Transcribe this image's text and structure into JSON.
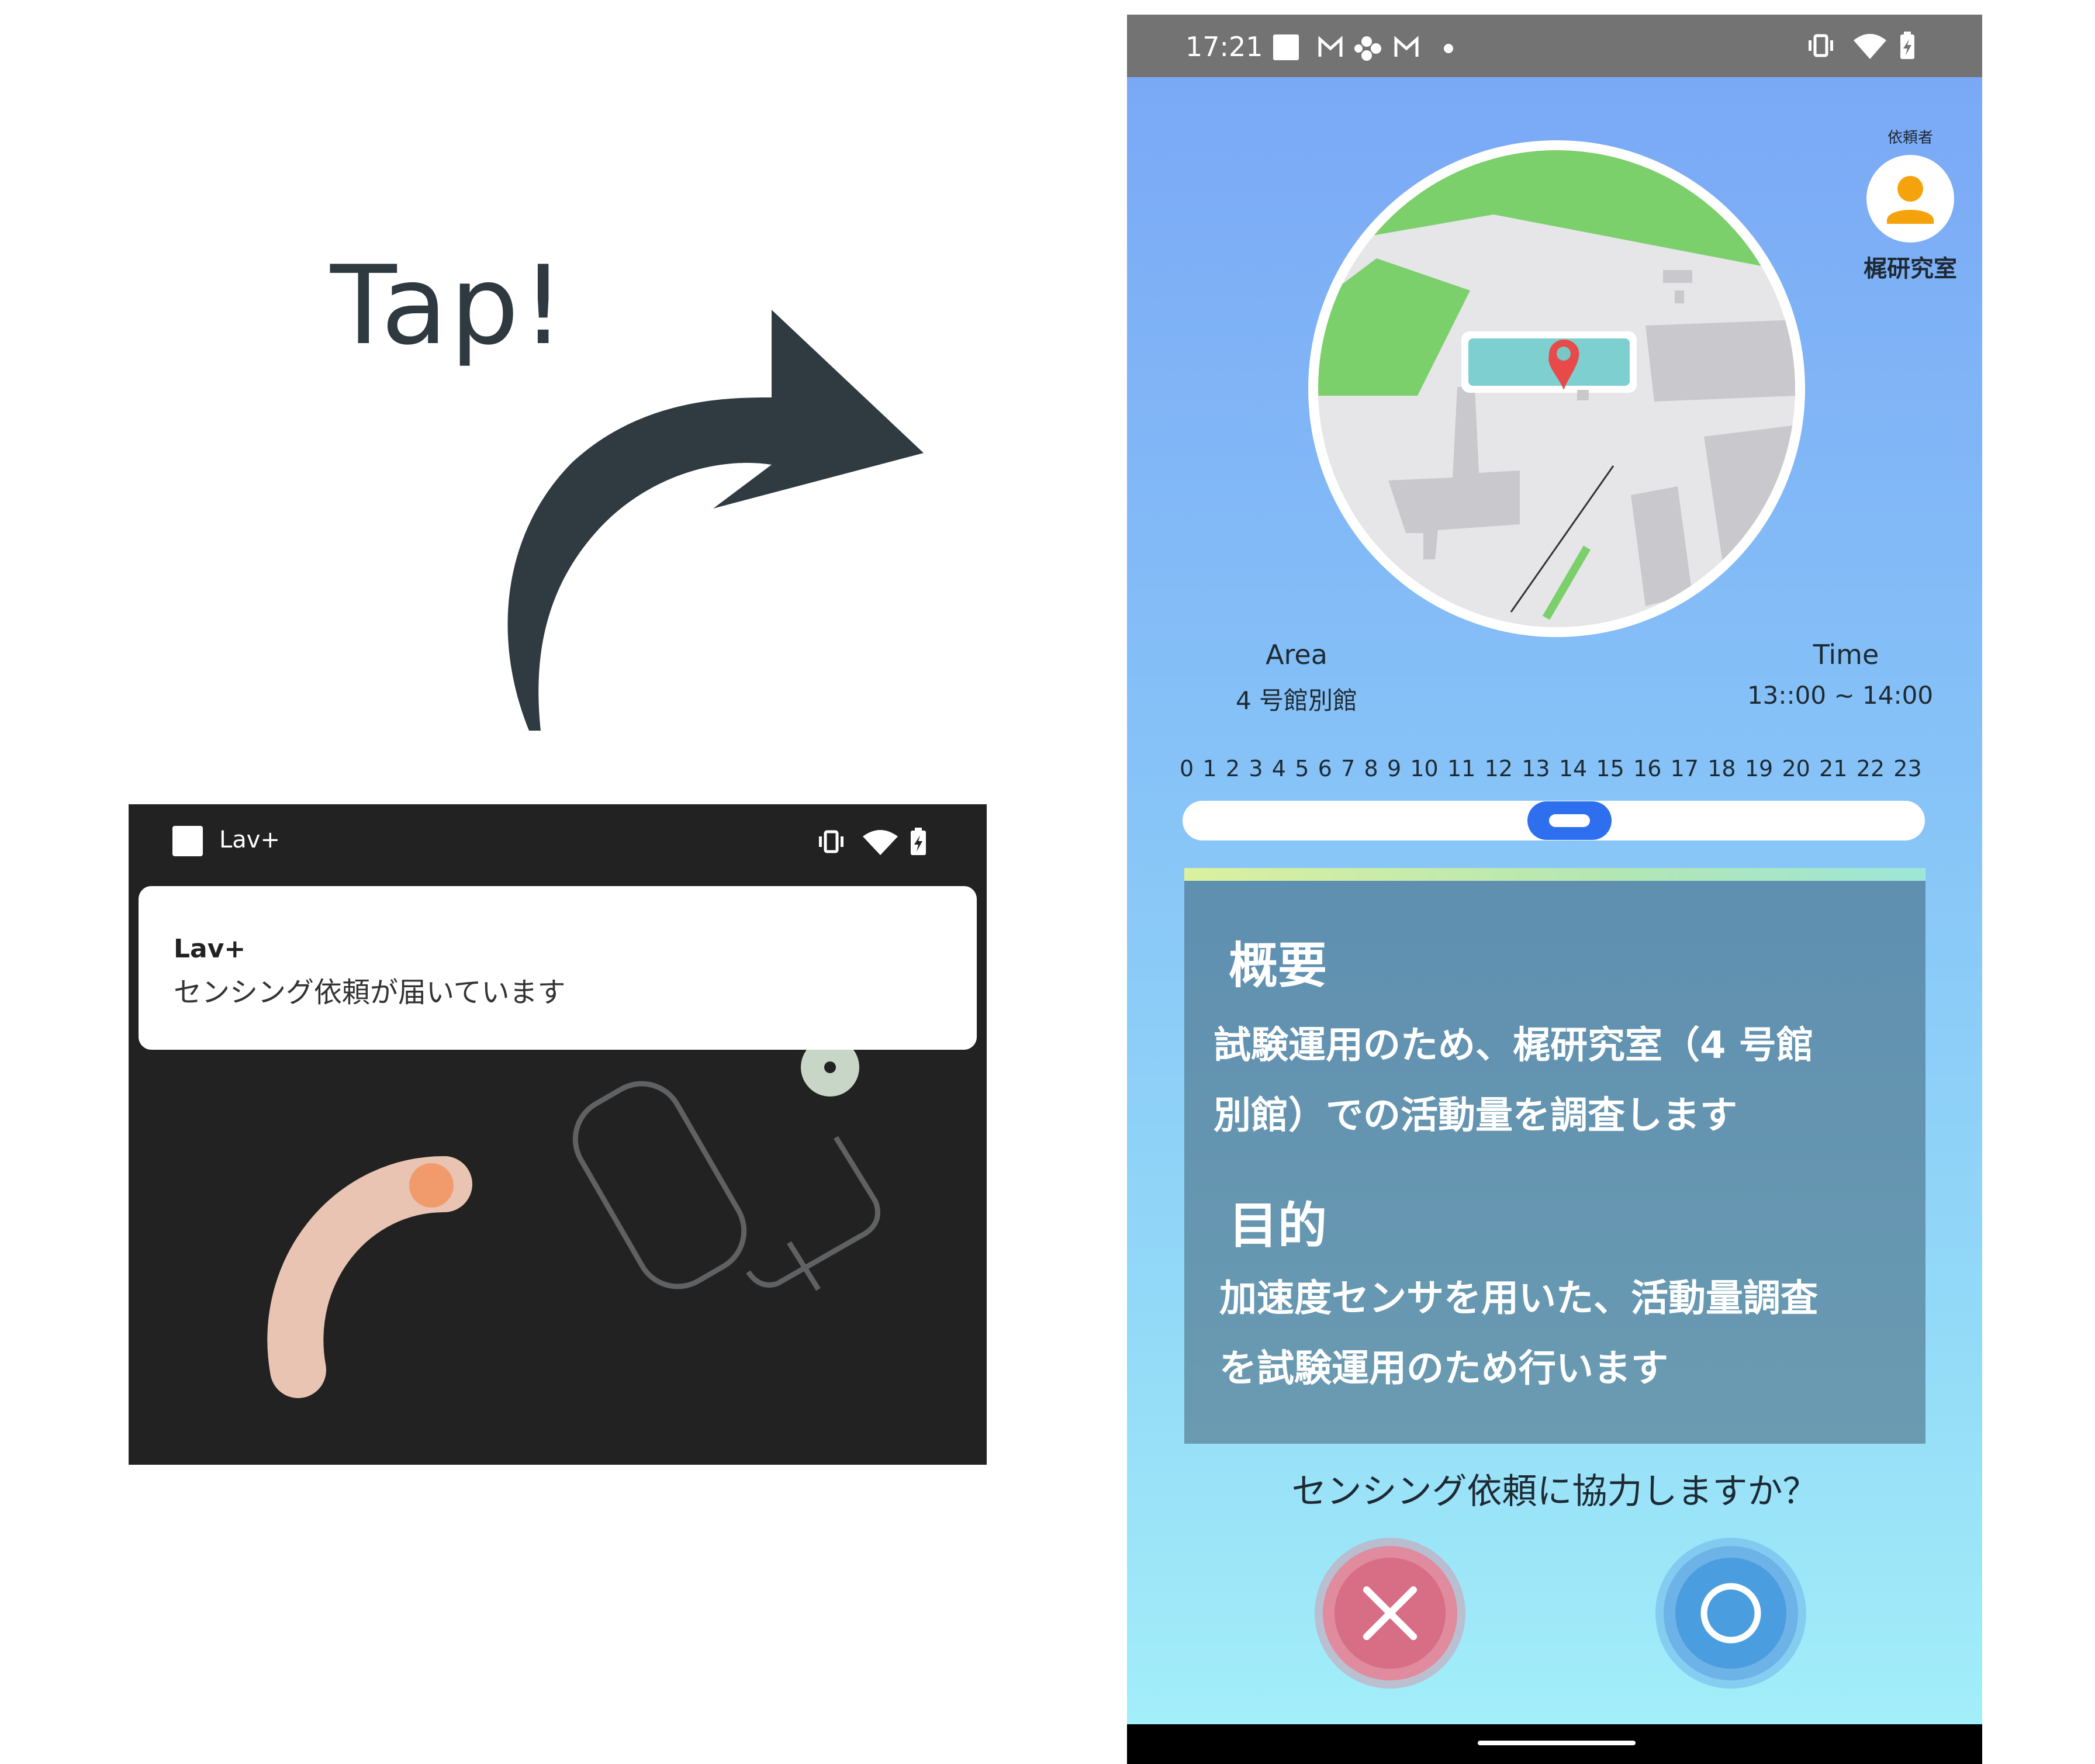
{
  "annotation": {
    "tap_label": "Tap!"
  },
  "lockscreen": {
    "app_name": "Lav+",
    "notification": {
      "title": "Lav+",
      "body": "センシング依頼が届いています"
    }
  },
  "app": {
    "status_bar": {
      "time": "17:21"
    },
    "requester": {
      "label": "依頼者",
      "name": "梶研究室"
    },
    "area": {
      "label": "Area",
      "value": "4 号館別館"
    },
    "time": {
      "label": "Time",
      "value": "13::00 ~ 14:00"
    },
    "timeline": {
      "hours": [
        "0",
        "1",
        "2",
        "3",
        "4",
        "5",
        "6",
        "7",
        "8",
        "9",
        "10",
        "11",
        "12",
        "13",
        "14",
        "15",
        "16",
        "17",
        "18",
        "19",
        "20",
        "21",
        "22",
        "23"
      ],
      "selected_hour": "13"
    },
    "overview": {
      "heading": "概要",
      "line1": "試験運用のため、梶研究室（4 号館",
      "line2": "別館）での活動量を調査します"
    },
    "purpose": {
      "heading": "目的",
      "line1": "加速度センサを用いた、活動量調査",
      "line2": "を試験運用のため行います"
    },
    "question": "センシング依頼に協力しますか？",
    "buttons": {
      "decline_icon": "close-x-icon",
      "accept_icon": "circle-o-icon"
    },
    "colors": {
      "decline": "#d86d86",
      "accept": "#4a9ee0",
      "thumb": "#2e6ff0"
    }
  }
}
